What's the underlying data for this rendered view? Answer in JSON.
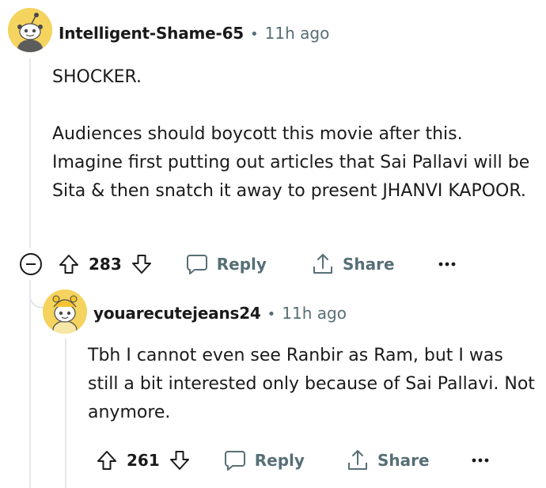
{
  "comment": {
    "username": "Intelligent-Shame-65",
    "separator": "•",
    "timestamp": "11h ago",
    "paragraphs": [
      "SHOCKER.",
      "Audiences should boycott this movie after this. Imagine first putting out articles that Sai Pallavi will be Sita & then snatch it away to present JHANVI KAPOOR."
    ],
    "score": "283",
    "reply_label": "Reply",
    "share_label": "Share"
  },
  "reply": {
    "username": "youarecutejeans24",
    "separator": "•",
    "timestamp": "11h ago",
    "text": "Tbh I cannot even see Ranbir as Ram, but I was still a bit interested only because of Sai Pallavi. Not anymore.",
    "score": "261",
    "reply_label": "Reply",
    "share_label": "Share"
  },
  "colors": {
    "text": "#1a1a1b",
    "meta": "#576f76",
    "thread_line": "#e5e7eb",
    "avatar_yellow": "#f4d35e"
  },
  "icons": [
    "collapse-icon",
    "upvote-icon",
    "downvote-icon",
    "comment-icon",
    "share-icon",
    "more-icon"
  ]
}
